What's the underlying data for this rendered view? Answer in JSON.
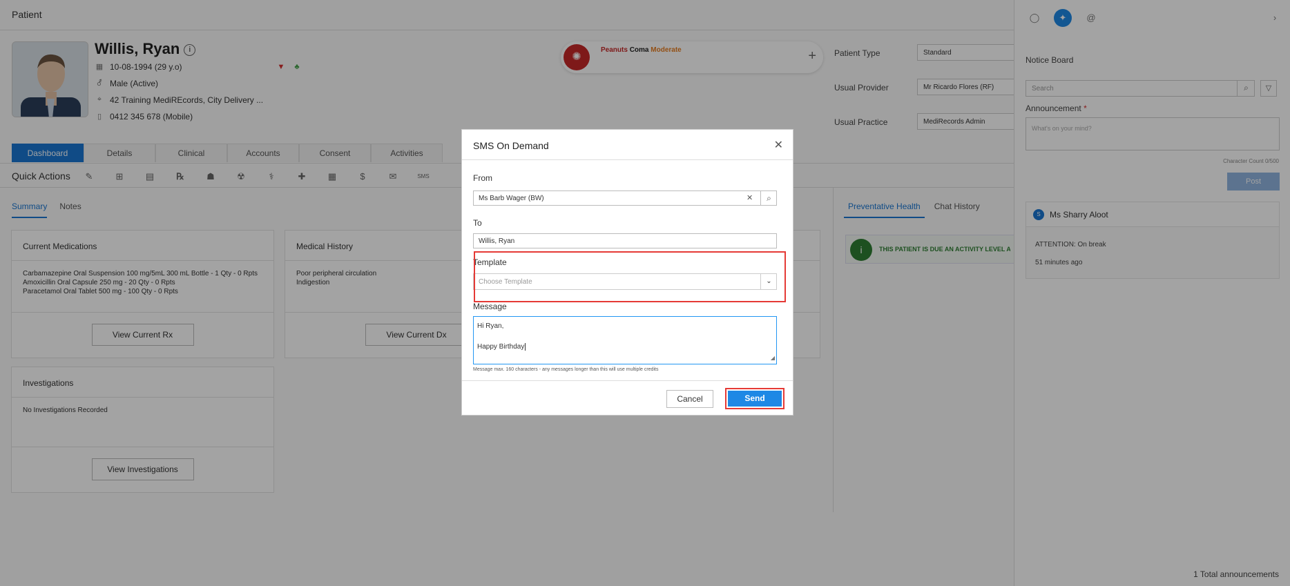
{
  "page_title": "Patient",
  "patient": {
    "name": "Willis, Ryan",
    "dob": "10-08-1994 (29 y.o)",
    "sex": "Male (Active)",
    "address": "42 Training MediREcords, City Delivery ...",
    "phone": "0412 345 678 (Mobile)"
  },
  "allergies": {
    "items": [
      "Peanuts",
      "Coma",
      "Moderate"
    ]
  },
  "fields": {
    "patient_type_label": "Patient Type",
    "patient_type_value": "Standard",
    "usual_provider_label": "Usual Provider",
    "usual_provider_value": "Mr Ricardo Flores (RF)",
    "usual_practice_label": "Usual Practice",
    "usual_practice_value": "MediRecords Admin"
  },
  "tabs": [
    "Dashboard",
    "Details",
    "Clinical",
    "Accounts",
    "Consent",
    "Activities"
  ],
  "quick_actions_label": "Quick Actions",
  "subtabs": [
    "Summary",
    "Notes"
  ],
  "cards": {
    "medications": {
      "title": "Current Medications",
      "lines": [
        "Carbamazepine Oral Suspension 100 mg/5mL 300 mL Bottle - 1 Qty - 0 Rpts",
        "Amoxicillin Oral Capsule 250 mg - 20 Qty - 0 Rpts",
        "Paracetamol Oral Tablet 500 mg - 100 Qty - 0 Rpts"
      ],
      "button": "View Current Rx"
    },
    "history": {
      "title": "Medical History",
      "lines": [
        "Poor peripheral circulation",
        "Indigestion"
      ],
      "button": "View Current Dx"
    },
    "investigations": {
      "title": "Investigations",
      "lines": [
        "No Investigations Recorded"
      ],
      "button": "View Investigations"
    }
  },
  "right_tabs": [
    "Preventative Health",
    "Chat History"
  ],
  "alert_text": "THIS PATIENT IS DUE AN ACTIVITY LEVEL ASSE",
  "panel": {
    "title": "Notice Board",
    "search_placeholder": "Search",
    "announcement_label": "Announcement",
    "announcement_placeholder": "What's on your mind?",
    "char_count": "Character Count 0/500",
    "post_label": "Post",
    "note": {
      "avatar": "S",
      "author": "Ms Sharry Aloot",
      "text": "ATTENTION: On break",
      "time": "51 minutes ago"
    },
    "total": "1 Total announcements"
  },
  "modal": {
    "title": "SMS On Demand",
    "from_label": "From",
    "from_value": "Ms Barb Wager (BW)",
    "to_label": "To",
    "to_value": "Willis, Ryan",
    "template_label": "Template",
    "template_placeholder": "Choose Template",
    "message_label": "Message",
    "message_line1": "Hi Ryan,",
    "message_line2": "Happy Birthday",
    "hint": "Message max. 160 characters - any messages longer than this will use multiple credits",
    "cancel_label": "Cancel",
    "send_label": "Send"
  },
  "colors": {
    "accent": "#1e88e5",
    "highlight": "#e53935",
    "allergy": "#c62828",
    "alert_green": "#2e7d32"
  }
}
